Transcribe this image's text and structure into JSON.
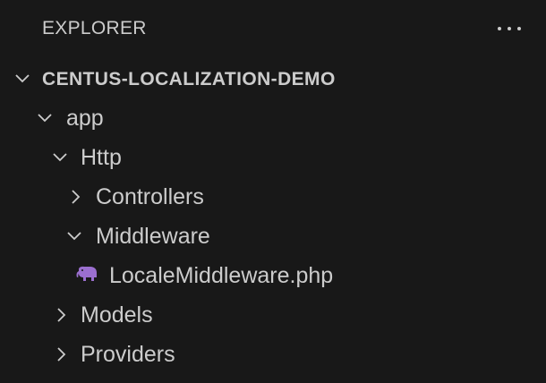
{
  "header": {
    "title": "EXPLORER",
    "more_icon": "ellipsis-icon"
  },
  "tree": {
    "root": {
      "label": "CENTUS-LOCALIZATION-DEMO",
      "expanded": true
    },
    "app": {
      "label": "app",
      "expanded": true
    },
    "http": {
      "label": "Http",
      "expanded": true
    },
    "controllers": {
      "label": "Controllers",
      "expanded": false
    },
    "middleware": {
      "label": "Middleware",
      "expanded": true
    },
    "locale_file": {
      "label": "LocaleMiddleware.php",
      "icon": "php-elephant-icon",
      "icon_color": "#9b6fcf"
    },
    "models": {
      "label": "Models",
      "expanded": false
    },
    "providers": {
      "label": "Providers",
      "expanded": false
    }
  },
  "colors": {
    "background": "#181818",
    "text": "#cccccc",
    "php_icon": "#9b6fcf"
  }
}
